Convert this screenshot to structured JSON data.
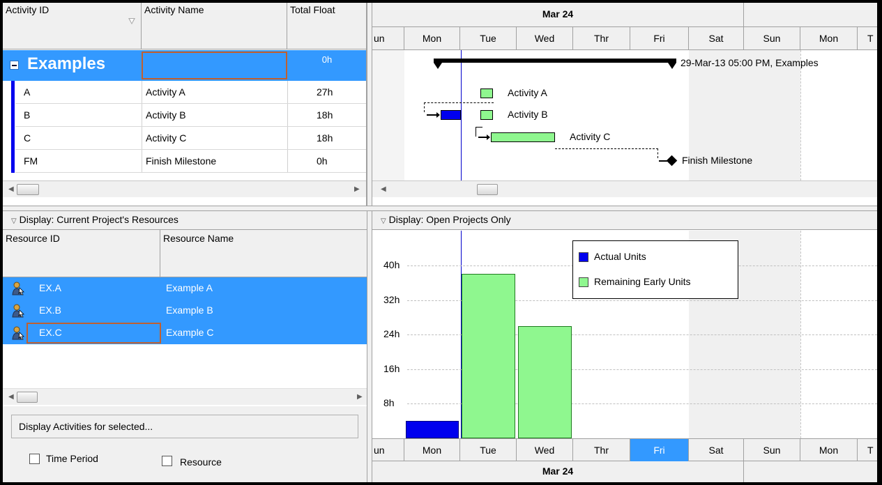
{
  "activity_table": {
    "headers": {
      "id": "Activity ID",
      "name": "Activity Name",
      "float": "Total Float"
    },
    "wbs": {
      "name": "Examples",
      "float": "0h"
    },
    "rows": [
      {
        "id": "A",
        "name": "Activity A",
        "float": "27h"
      },
      {
        "id": "B",
        "name": "Activity B",
        "float": "18h"
      },
      {
        "id": "C",
        "name": "Activity C",
        "float": "18h"
      },
      {
        "id": "FM",
        "name": "Finish Milestone",
        "float": "0h"
      }
    ]
  },
  "gantt": {
    "month": "Mar 24",
    "days": [
      "un",
      "Mon",
      "Tue",
      "Wed",
      "Thr",
      "Fri",
      "Sat",
      "Sun",
      "Mon",
      "T"
    ],
    "summary_label": "29-Mar-13 05:00 PM, Examples",
    "bar_labels": [
      "Activity A",
      "Activity B",
      "Activity C",
      "Finish Milestone"
    ]
  },
  "resources": {
    "display_label": "Display: Current Project's Resources",
    "headers": {
      "id": "Resource ID",
      "name": "Resource Name"
    },
    "rows": [
      {
        "id": "EX.A",
        "name": "Example A"
      },
      {
        "id": "EX.B",
        "name": "Example B"
      },
      {
        "id": "EX.C",
        "name": "Example C"
      }
    ],
    "display_activities_label": "Display Activities for selected...",
    "time_period_label": "Time Period",
    "resource_label": "Resource"
  },
  "histogram": {
    "display_label": "Display: Open Projects Only",
    "legend": {
      "actual": "Actual Units",
      "remaining": "Remaining Early Units"
    },
    "bottom_days": [
      "un",
      "Mon",
      "Tue",
      "Wed",
      "Thr",
      "Fri",
      "Sat",
      "Sun",
      "Mon",
      "T"
    ],
    "bottom_month": "Mar 24",
    "highlight_day": "Fri"
  },
  "colors": {
    "selection": "#3399ff",
    "actual": "#0000ee",
    "remaining": "#8ff78f",
    "weekend": "#f0f0f0"
  },
  "chart_data": {
    "type": "bar",
    "categories": [
      "Mon",
      "Tue",
      "Wed",
      "Thr",
      "Fri",
      "Sat",
      "Sun"
    ],
    "series": [
      {
        "name": "Actual Units",
        "values": [
          4,
          0,
          0,
          0,
          0,
          0,
          0
        ]
      },
      {
        "name": "Remaining Early Units",
        "values": [
          0,
          38,
          26,
          0,
          0,
          0,
          0
        ]
      }
    ],
    "yticks": [
      "8h",
      "16h",
      "24h",
      "32h",
      "40h"
    ],
    "ylim": [
      0,
      44
    ],
    "grid": true,
    "legend_position": "top-center"
  }
}
